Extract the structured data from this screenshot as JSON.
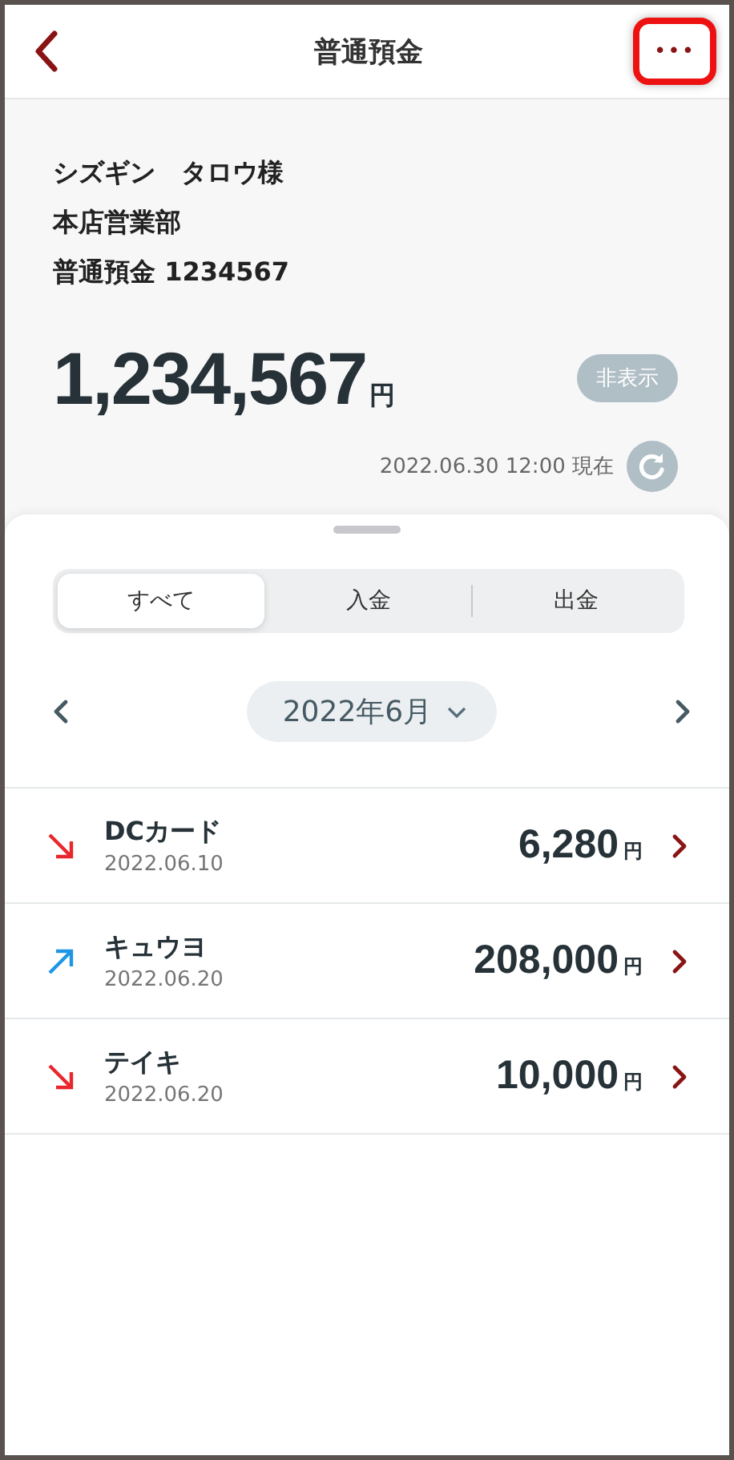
{
  "header": {
    "title": "普通預金",
    "menu_button": {
      "label": "•••",
      "highlighted": true
    }
  },
  "account": {
    "holder": "シズギン　タロウ様",
    "branch": "本店営業部",
    "account": "普通預金 1234567",
    "balance": "1,234,567",
    "currency": "円",
    "hide_button": "非表示",
    "as_of": "2022.06.30 12:00 現在"
  },
  "tabs": [
    {
      "label": "すべて",
      "selected": true
    },
    {
      "label": "入金",
      "selected": false
    },
    {
      "label": "出金",
      "selected": false
    }
  ],
  "month": {
    "label": "2022年6月"
  },
  "transactions": [
    {
      "kind": "out",
      "name": "DCカード",
      "date": "2022.06.10",
      "amount": "6,280",
      "currency": "円"
    },
    {
      "kind": "in",
      "name": "キュウヨ",
      "date": "2022.06.20",
      "amount": "208,000",
      "currency": "円"
    },
    {
      "kind": "out",
      "name": "テイキ",
      "date": "2022.06.20",
      "amount": "10,000",
      "currency": "円"
    }
  ]
}
